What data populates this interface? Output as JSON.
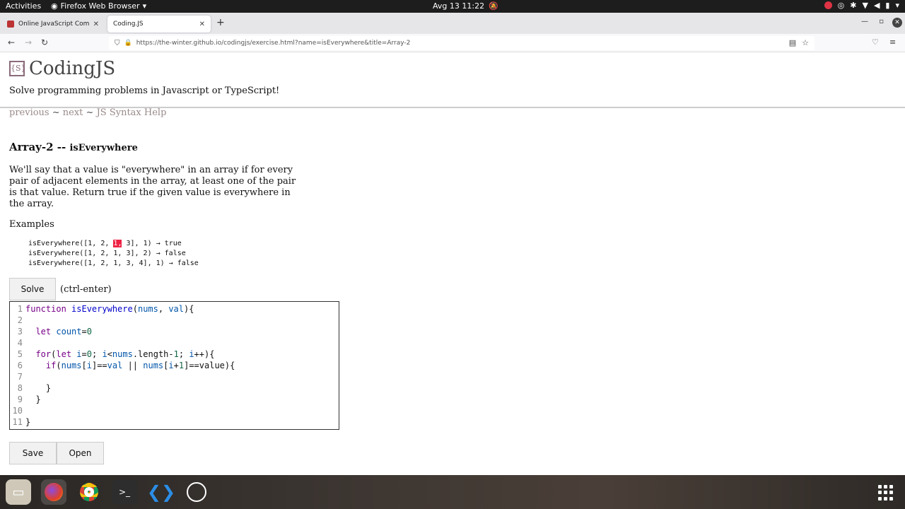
{
  "system_bar": {
    "activities": "Activities",
    "app_name": "Firefox Web Browser",
    "clock": "Avg 13  11:22"
  },
  "browser": {
    "tabs": [
      {
        "title": "Online JavaScript Compile",
        "active": false
      },
      {
        "title": "Coding.JS",
        "active": true
      }
    ],
    "url": "https://the-winter.github.io/codingjs/exercise.html?name=isEverywhere&title=Array-2"
  },
  "page": {
    "logo_icon": "{S}",
    "site_title": "CodingJS",
    "tagline": "Solve programming problems in Javascript or TypeScript!",
    "nav": {
      "previous": "previous",
      "sep1": " ~ ",
      "next": "next",
      "sep2": " ~ ",
      "help": "JS Syntax Help"
    },
    "problem_category": "Array-2 -- ",
    "problem_name": "isEverywhere",
    "description": "We'll say that a value is \"everywhere\" in an array if for every pair of adjacent elements in the array, at least one of the pair is that value. Return true if the given value is everywhere in the array.",
    "examples_label": "Examples",
    "examples": [
      {
        "pre": "isEverywhere([1, 2, ",
        "hl": "1,",
        "post": " 3], 1) → true"
      },
      {
        "pre": "isEverywhere([1, 2, 1, 3], 2) → false",
        "hl": "",
        "post": ""
      },
      {
        "pre": "isEverywhere([1, 2, 1, 3, 4], 1) → false",
        "hl": "",
        "post": ""
      }
    ],
    "solve_label": "Solve",
    "hotkey_label": "(ctrl-enter)",
    "save_label": "Save",
    "open_label": "Open"
  },
  "editor": {
    "line_numbers": [
      "1",
      "2",
      "3",
      "4",
      "5",
      "6",
      "7",
      "8",
      "9",
      "10",
      "11"
    ]
  },
  "dock": {
    "items": [
      "files-icon",
      "firefox-icon",
      "chrome-icon",
      "terminal-icon",
      "vscode-icon",
      "obs-icon"
    ]
  }
}
